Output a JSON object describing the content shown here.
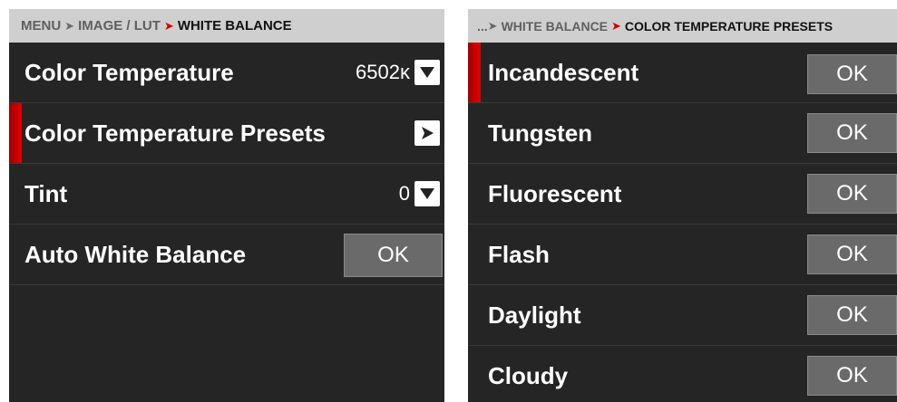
{
  "colors": {
    "panel_bg": "#252525",
    "breadcrumb_bg": "#cfcfcf",
    "accent_red": "#d00000",
    "ok_button_bg": "#6a6a6a"
  },
  "left_panel": {
    "breadcrumb": {
      "items": [
        "MENU",
        "IMAGE / LUT",
        "WHITE BALANCE"
      ],
      "separator_icon": "chevron-right-icon"
    },
    "rows": {
      "color_temperature": {
        "label": "Color Temperature",
        "value": "6502ᴋ",
        "icon": "chevron-down-icon"
      },
      "presets": {
        "label": "Color Temperature Presets",
        "icon": "chevron-right-icon",
        "selected": true
      },
      "tint": {
        "label": "Tint",
        "value": "0",
        "icon": "chevron-down-icon"
      },
      "auto_wb": {
        "label": "Auto White Balance",
        "button": "OK"
      }
    }
  },
  "right_panel": {
    "breadcrumb": {
      "prefix": "...",
      "parent": "WHITE BALANCE",
      "current": "COLOR TEMPERATURE PRESETS"
    },
    "presets": [
      {
        "label": "Incandescent",
        "button": "OK",
        "selected": true
      },
      {
        "label": "Tungsten",
        "button": "OK"
      },
      {
        "label": "Fluorescent",
        "button": "OK"
      },
      {
        "label": "Flash",
        "button": "OK"
      },
      {
        "label": "Daylight",
        "button": "OK"
      },
      {
        "label": "Cloudy",
        "button": "OK"
      }
    ]
  }
}
